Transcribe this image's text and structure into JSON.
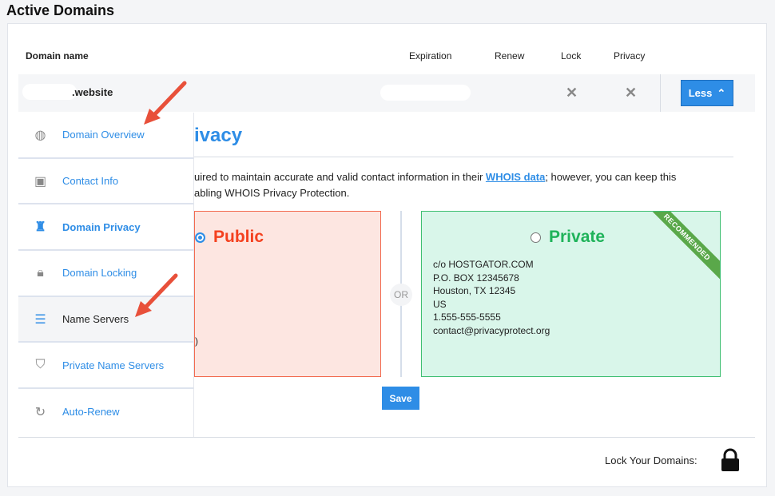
{
  "page_title": "Active Domains",
  "table": {
    "headers": [
      "Domain name",
      "Expiration",
      "Renew",
      "Lock",
      "Privacy"
    ],
    "row": {
      "domain": ".website",
      "lock": "✕",
      "privacy": "✕",
      "less_label": "Less"
    }
  },
  "menu": [
    {
      "label": "Domain Overview",
      "icon": "globe-icon"
    },
    {
      "label": "Contact Info",
      "icon": "contact-card-icon"
    },
    {
      "label": "Domain Privacy",
      "icon": "spy-icon"
    },
    {
      "label": "Domain Locking",
      "icon": "lock-icon"
    },
    {
      "label": "Name Servers",
      "icon": "server-icon"
    },
    {
      "label": "Private Name Servers",
      "icon": "shield-icon"
    },
    {
      "label": "Auto-Renew",
      "icon": "refresh-icon"
    }
  ],
  "privacy": {
    "title": "ivacy",
    "desc_1a": "uired to maintain accurate and valid contact information in their ",
    "whois_link": "WHOIS data",
    "desc_1b": "; however, you can keep this",
    "desc_2": "abling WHOIS Privacy Protection.",
    "public_label": "Public",
    "public_fragment": ")",
    "or": "OR",
    "private_label": "Private",
    "ribbon": "RECOMMENDED",
    "address": [
      "c/o HOSTGATOR.COM",
      "P.O. BOX 12345678",
      "Houston, TX 12345",
      "US",
      "1.555-555-5555",
      "contact@privacyprotect.org"
    ],
    "save": "Save"
  },
  "footer": {
    "lock_label": "Lock Your Domains:"
  },
  "colors": {
    "accent": "#2e8de6",
    "public": "#f4411f",
    "private": "#1fb35a",
    "arrow": "#e8503a"
  }
}
